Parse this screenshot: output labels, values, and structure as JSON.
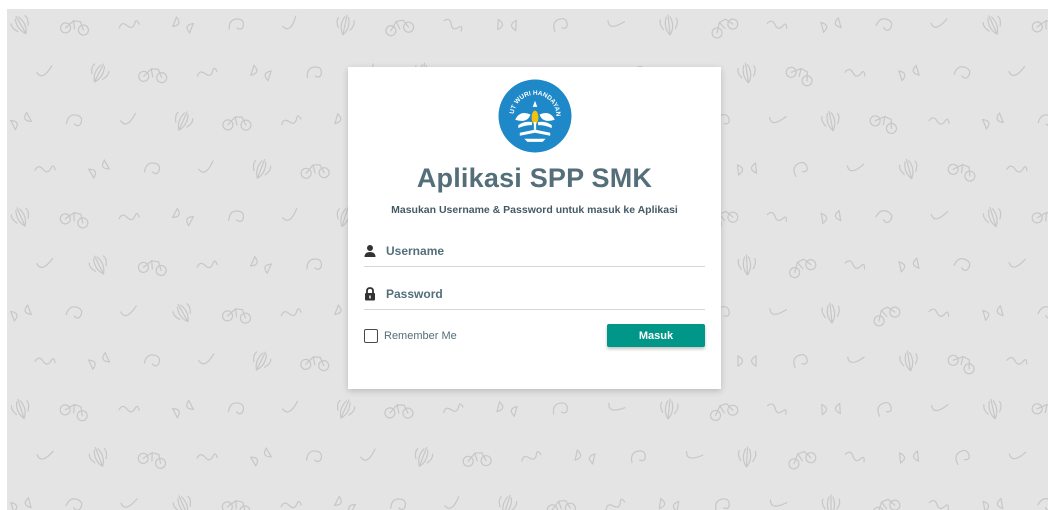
{
  "page": {
    "background_color": "#e4e4e4"
  },
  "logo": {
    "name": "tut-wuri-handayani-logo",
    "text": "TUT WURI HANDAYANI",
    "color": "#1e88c8"
  },
  "login": {
    "title": "Aplikasi SPP SMK",
    "subtitle": "Masukan Username & Password untuk masuk ke Aplikasi",
    "username": {
      "icon": "user-icon",
      "placeholder": "Username",
      "value": ""
    },
    "password": {
      "icon": "lock-icon",
      "placeholder": "Password",
      "value": ""
    },
    "remember_label": "Remember Me",
    "remember_checked": false,
    "submit_label": "Masuk",
    "accent_color": "#009688",
    "title_color": "#546e7a"
  }
}
